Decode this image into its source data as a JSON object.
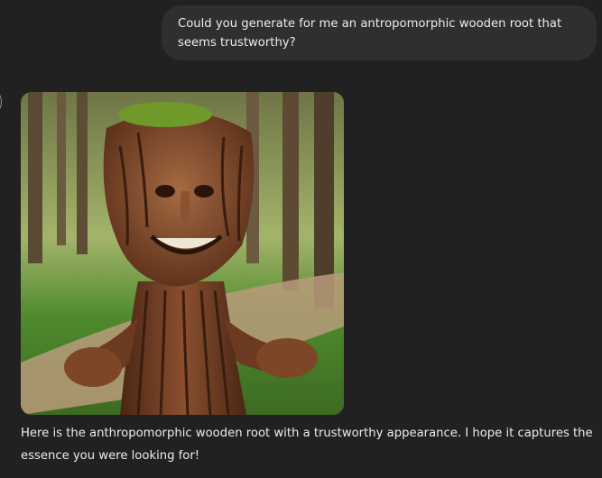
{
  "conversation": {
    "user_message": "Could you generate for me an antropomorphic wooden root that seems trustworthy?",
    "assistant_reply": "Here is the anthropomorphic wooden root with a trustworthy appearance. I hope it captures the essence you were looking for!",
    "image_icon": "generated-image"
  },
  "colors": {
    "background": "#212121",
    "bubble": "#2f2f2f",
    "text": "#ececec"
  }
}
